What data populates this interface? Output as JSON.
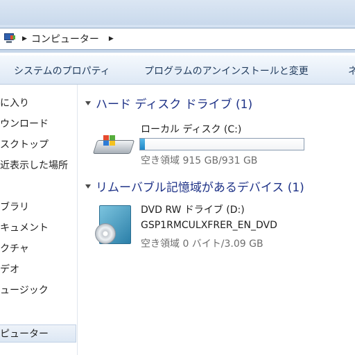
{
  "address_bar": {
    "crumbs": [
      "コンピューター"
    ]
  },
  "toolbar": {
    "system_properties": "システムのプロパティ",
    "uninstall_program": "プログラムのアンインストールと変更",
    "overflow": "ネ"
  },
  "nav": {
    "items": [
      "に入り",
      "ウンロード",
      "スクトップ",
      "近表示した場所",
      "ブラリ",
      "キュメント",
      "クチャ",
      "デオ",
      "ュージック",
      "ピューター"
    ],
    "selected_index": 9
  },
  "groups": {
    "hdd": {
      "title": "ハード ディスク ドライブ (1)",
      "items": [
        {
          "name": "ローカル ディスク (C:)",
          "free": "空き領域 915 GB/931 GB",
          "used_fraction": 0.017
        }
      ]
    },
    "removable": {
      "title": "リムーバブル記憶域があるデバイス (1)",
      "items": [
        {
          "name": "DVD RW ドライブ (D:)",
          "label": "GSP1RMCULXFRER_EN_DVD",
          "free": "空き領域 0 バイト/3.09 GB"
        }
      ]
    }
  },
  "colors": {
    "group_title": "#1e3287",
    "toolbar_text": "#1e395b",
    "progress_fill": "#1f86c6"
  }
}
